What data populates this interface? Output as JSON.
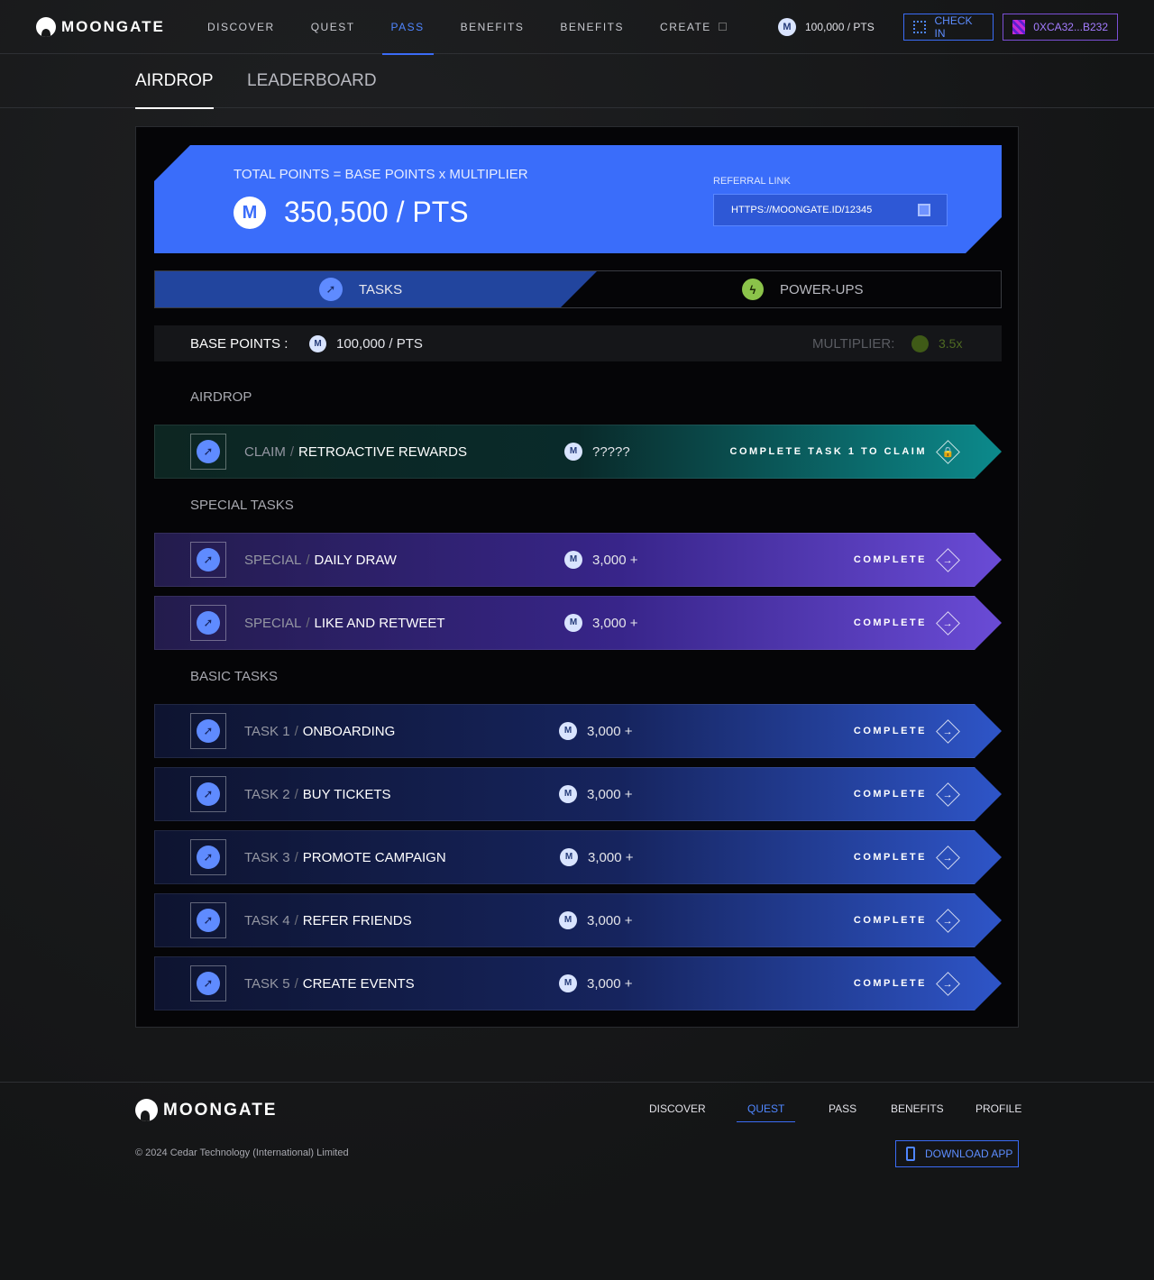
{
  "header": {
    "brand": "MOONGATE",
    "nav": [
      {
        "label": "DISCOVER"
      },
      {
        "label": "QUEST"
      },
      {
        "label": "PASS"
      },
      {
        "label": "BENEFITS"
      },
      {
        "label": "BENEFITS"
      },
      {
        "label": "CREATE"
      }
    ],
    "active_nav": "PASS",
    "points": "100,000 / PTS",
    "coin_letter": "M",
    "checkin_label": "CHECK IN",
    "wallet_label": "0XCA32...B232"
  },
  "subtabs": {
    "airdrop": "AIRDROP",
    "leaderboard": "LEADERBOARD"
  },
  "hero": {
    "formula": "TOTAL POINTS = BASE POINTS x MULTIPLIER",
    "total": "350,500 / PTS",
    "referral_label": "REFERRAL LINK",
    "referral_link": "HTTPS://MOONGATE.ID/12345"
  },
  "tabs": {
    "tasks": "TASKS",
    "powerups": "POWER-UPS"
  },
  "base": {
    "label": "BASE POINTS :",
    "value": "100,000 / PTS",
    "multiplier_label": "MULTIPLIER:",
    "multiplier_value": "3.5x"
  },
  "sections": {
    "airdrop": "AIRDROP",
    "special": "SPECIAL TASKS",
    "basic": "BASIC TASKS"
  },
  "airdrop_task": {
    "prefix": "CLAIM",
    "title": "RETROACTIVE REWARDS",
    "reward": "?????",
    "action": "COMPLETE TASK 1 TO CLAIM"
  },
  "special_tasks": [
    {
      "prefix": "SPECIAL",
      "title": "DAILY DRAW",
      "reward": "3,000 +",
      "action": "COMPLETE"
    },
    {
      "prefix": "SPECIAL",
      "title": "LIKE AND RETWEET",
      "reward": "3,000 +",
      "action": "COMPLETE"
    }
  ],
  "basic_tasks": [
    {
      "prefix": "TASK 1",
      "title": "ONBOARDING",
      "reward": "3,000 +",
      "action": "COMPLETE"
    },
    {
      "prefix": "TASK 2",
      "title": "BUY TICKETS",
      "reward": "3,000 +",
      "action": "COMPLETE"
    },
    {
      "prefix": "TASK 3",
      "title": "PROMOTE CAMPAIGN",
      "reward": "3,000 +",
      "action": "COMPLETE"
    },
    {
      "prefix": "TASK 4",
      "title": "REFER FRIENDS",
      "reward": "3,000 +",
      "action": "COMPLETE"
    },
    {
      "prefix": "TASK 5",
      "title": "CREATE EVENTS",
      "reward": "3,000 +",
      "action": "COMPLETE"
    }
  ],
  "separator": "/",
  "footer": {
    "brand": "MOONGATE",
    "nav": [
      {
        "label": "DISCOVER"
      },
      {
        "label": "QUEST"
      },
      {
        "label": "PASS"
      },
      {
        "label": "BENEFITS"
      },
      {
        "label": "PROFILE"
      }
    ],
    "active_nav": "QUEST",
    "copyright": "© 2024 Cedar Technology (International) Limited",
    "download_label": "DOWNLOAD APP"
  },
  "colors": {
    "accent": "#3a6dfa",
    "airdrop_task": "#0c8a8c",
    "special_task": "#6a4bd6",
    "basic_task": "#2e55c8",
    "wallet": "#a47cff"
  },
  "icons": {
    "task": "rocket-icon",
    "powerup": "lightning-icon",
    "coin": "moongate-coin-icon",
    "lock": "lock-icon",
    "arrow": "arrow-right-icon"
  }
}
